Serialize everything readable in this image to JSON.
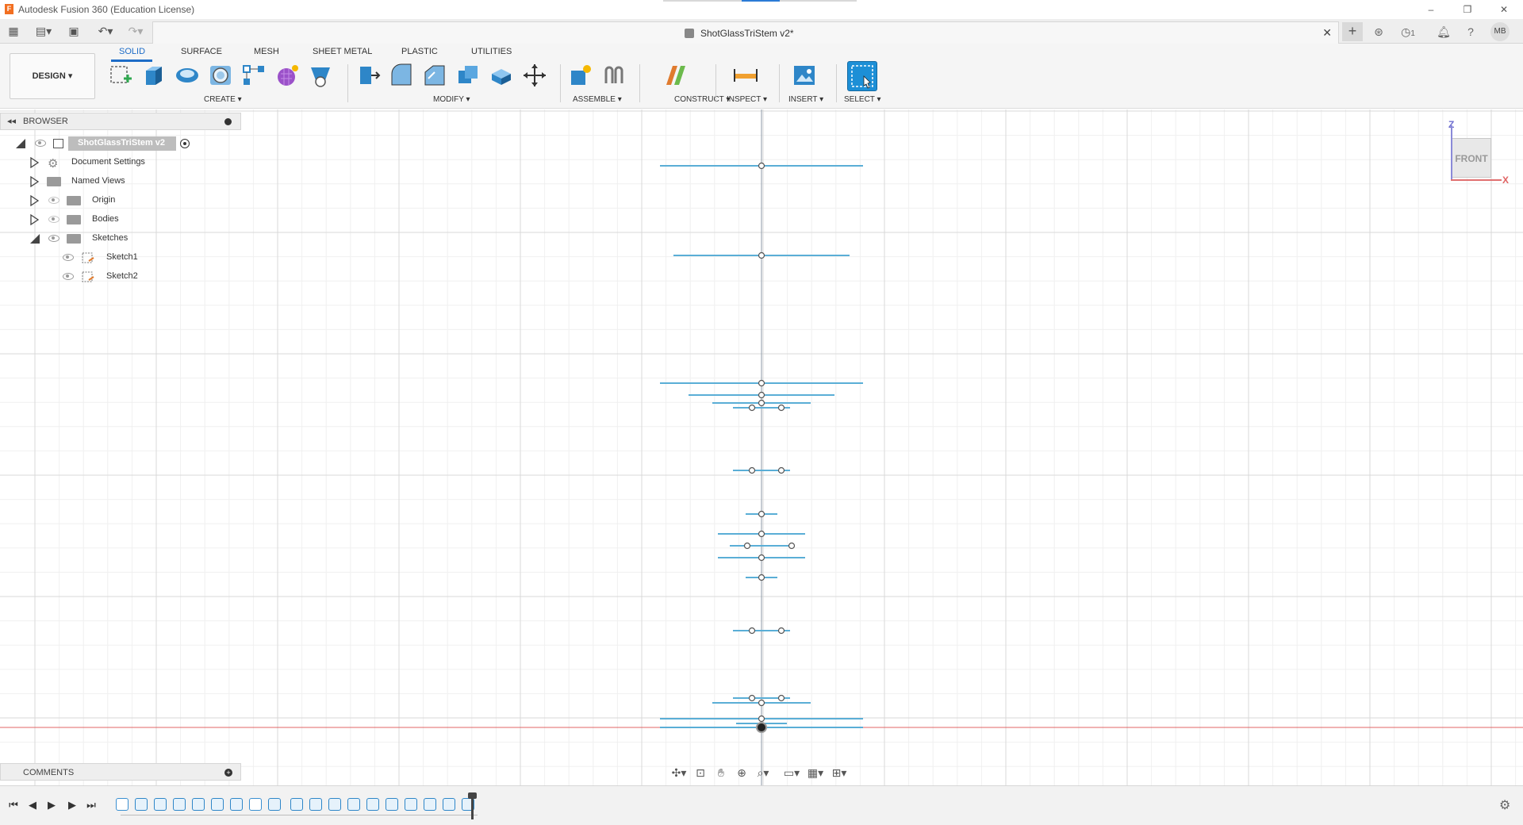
{
  "window": {
    "title": "Autodesk Fusion 360 (Education License)",
    "app_icon": "F",
    "minimize": "–",
    "maximize": "❐",
    "close": "✕"
  },
  "filebar": {
    "doc_title": "ShotGlassTriStem v2*",
    "notifications": "1",
    "user_initials": "MB"
  },
  "toolbar": {
    "workspace": "DESIGN",
    "tabs": [
      "SOLID",
      "SURFACE",
      "MESH",
      "SHEET METAL",
      "PLASTIC",
      "UTILITIES"
    ],
    "active_tab": "SOLID",
    "groups": [
      "CREATE",
      "MODIFY",
      "ASSEMBLE",
      "CONSTRUCT",
      "INSPECT",
      "INSERT",
      "SELECT"
    ]
  },
  "browser": {
    "header": "BROWSER",
    "root": "ShotGlassTriStem v2",
    "items": [
      {
        "label": "Document Settings"
      },
      {
        "label": "Named Views"
      },
      {
        "label": "Origin"
      },
      {
        "label": "Bodies"
      },
      {
        "label": "Sketches"
      },
      {
        "label": "Sketch1"
      },
      {
        "label": "Sketch2"
      }
    ]
  },
  "comments": {
    "header": "COMMENTS"
  },
  "viewcube": {
    "face": "FRONT",
    "axis_z": "Z",
    "axis_x": "X"
  },
  "colors": {
    "sketch_line": "#5aaed6",
    "accent": "#1d6cc7",
    "x_axis": "#e06464",
    "grid": "#e4e4e4"
  }
}
